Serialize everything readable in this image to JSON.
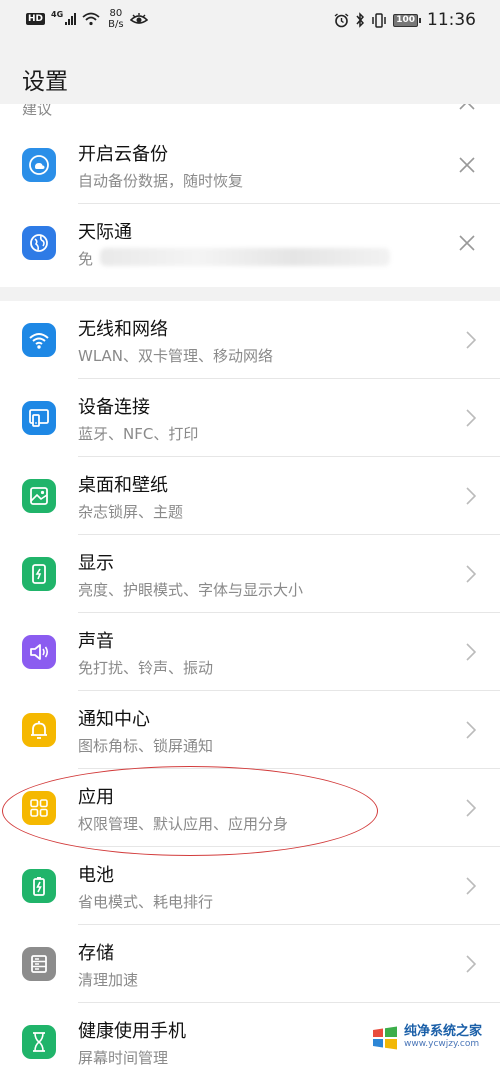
{
  "status_bar": {
    "hd": "HD",
    "network": "4G",
    "speed_value": "80",
    "speed_unit": "B/s",
    "battery": "100",
    "time": "11:36"
  },
  "header": {
    "title": "设置"
  },
  "suggestions": {
    "label": "建议",
    "items": [
      {
        "title": "开启云备份",
        "subtitle": "自动备份数据，随时恢复",
        "icon": "cloud-backup-icon",
        "color": "#2b8fe8"
      },
      {
        "title": "天际通",
        "subtitle": "免",
        "icon": "globe-icon",
        "color": "#2e7be6"
      }
    ]
  },
  "settings": {
    "items": [
      {
        "title": "无线和网络",
        "subtitle": "WLAN、双卡管理、移动网络",
        "icon": "wifi-icon",
        "color": "#1e88e5"
      },
      {
        "title": "设备连接",
        "subtitle": "蓝牙、NFC、打印",
        "icon": "device-connect-icon",
        "color": "#1e88e5"
      },
      {
        "title": "桌面和壁纸",
        "subtitle": "杂志锁屏、主题",
        "icon": "wallpaper-icon",
        "color": "#20b46a"
      },
      {
        "title": "显示",
        "subtitle": "亮度、护眼模式、字体与显示大小",
        "icon": "display-icon",
        "color": "#20b46a"
      },
      {
        "title": "声音",
        "subtitle": "免打扰、铃声、振动",
        "icon": "sound-icon",
        "color": "#8b5cf0"
      },
      {
        "title": "通知中心",
        "subtitle": "图标角标、锁屏通知",
        "icon": "bell-icon",
        "color": "#f5b800"
      },
      {
        "title": "应用",
        "subtitle": "权限管理、默认应用、应用分身",
        "icon": "apps-grid-icon",
        "color": "#f5b800"
      },
      {
        "title": "电池",
        "subtitle": "省电模式、耗电排行",
        "icon": "battery-icon",
        "color": "#20b46a"
      },
      {
        "title": "存储",
        "subtitle": "清理加速",
        "icon": "storage-icon",
        "color": "#8c8c8c"
      },
      {
        "title": "健康使用手机",
        "subtitle": "屏幕时间管理",
        "icon": "hourglass-icon",
        "color": "#20b46a"
      }
    ]
  },
  "watermark": {
    "title": "纯净系统之家",
    "url": "www.ycwjzy.com"
  }
}
